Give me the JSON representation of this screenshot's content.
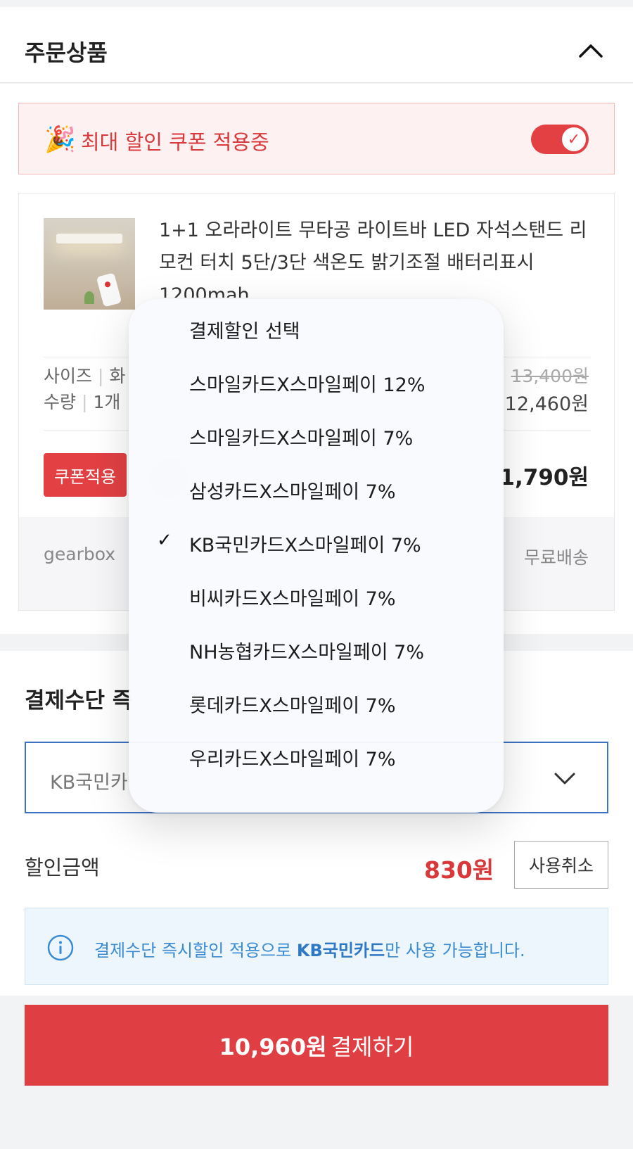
{
  "header": {
    "title": "주문상품"
  },
  "coupon_banner": {
    "emoji": "🎉",
    "text": "최대 할인 쿠폰 적용중",
    "toggle_on": true
  },
  "product": {
    "name": "1+1 오라라이트 무타공 라이트바 LED 자석스탠드 리모컨 터치 5단/3단 색온도 밝기조절 배터리표시 1200mah",
    "option_size_label": "사이즈",
    "option_size_value": "화",
    "option_qty_label": "수량",
    "option_qty_value": "1개",
    "price_original": "13,400원",
    "price_sale": "12,460원",
    "coupon_button": "쿠폰적용",
    "price_final": "1,790원",
    "seller": "gearbox",
    "shipping": "무료배송"
  },
  "payment": {
    "title": "결제수단 즉",
    "selected_value": "KB국민카",
    "discount_label": "할인금액",
    "discount_amount": "830원",
    "cancel_button": "사용취소",
    "info_prefix": "결제수단 즉시할인 적용으로 ",
    "info_bold": "KB국민카드",
    "info_suffix": "만 사용 가능합니다.",
    "pay_button_amount": "10,960원",
    "pay_button_label": "결제하기"
  },
  "dropdown_menu": {
    "checked_index": 4,
    "items": [
      "결제할인 선택",
      "스마일카드X스마일페이 12%",
      "스마일카드X스마일페이 7%",
      "삼성카드X스마일페이 7%",
      "KB국민카드X스마일페이 7%",
      "비씨카드X스마일페이 7%",
      "NH농협카드X스마일페이 7%",
      "롯데카드X스마일페이 7%",
      "우리카드X스마일페이 7%"
    ]
  },
  "colors": {
    "accent_red": "#e24043",
    "info_blue": "#3a8bd1",
    "select_border": "#3d72c2"
  }
}
